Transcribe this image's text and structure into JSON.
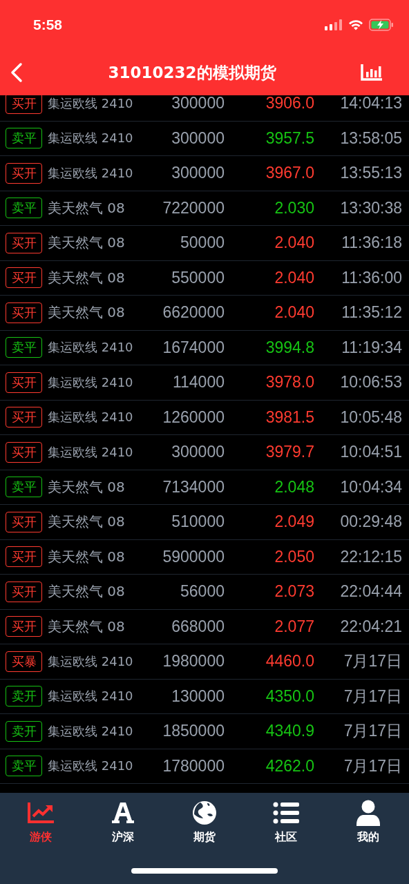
{
  "status_bar": {
    "time": "5:58"
  },
  "header": {
    "title": "31010232的模拟期货"
  },
  "trades": [
    {
      "kind": "buy",
      "action": "买开",
      "contract": "集运欧线 2410",
      "quantity": "300000",
      "price": "3906.0",
      "time": "14:04:13"
    },
    {
      "kind": "sell",
      "action": "卖平",
      "contract": "集运欧线 2410",
      "quantity": "300000",
      "price": "3957.5",
      "time": "13:58:05"
    },
    {
      "kind": "buy",
      "action": "买开",
      "contract": "集运欧线 2410",
      "quantity": "300000",
      "price": "3967.0",
      "time": "13:55:13"
    },
    {
      "kind": "sell",
      "action": "卖平",
      "contract": "美天然气 08",
      "quantity": "7220000",
      "price": "2.030",
      "time": "13:30:38"
    },
    {
      "kind": "buy",
      "action": "买开",
      "contract": "美天然气 08",
      "quantity": "50000",
      "price": "2.040",
      "time": "11:36:18"
    },
    {
      "kind": "buy",
      "action": "买开",
      "contract": "美天然气 08",
      "quantity": "550000",
      "price": "2.040",
      "time": "11:36:00"
    },
    {
      "kind": "buy",
      "action": "买开",
      "contract": "美天然气 08",
      "quantity": "6620000",
      "price": "2.040",
      "time": "11:35:12"
    },
    {
      "kind": "sell",
      "action": "卖平",
      "contract": "集运欧线 2410",
      "quantity": "1674000",
      "price": "3994.8",
      "time": "11:19:34"
    },
    {
      "kind": "buy",
      "action": "买开",
      "contract": "集运欧线 2410",
      "quantity": "114000",
      "price": "3978.0",
      "time": "10:06:53"
    },
    {
      "kind": "buy",
      "action": "买开",
      "contract": "集运欧线 2410",
      "quantity": "1260000",
      "price": "3981.5",
      "time": "10:05:48"
    },
    {
      "kind": "buy",
      "action": "买开",
      "contract": "集运欧线 2410",
      "quantity": "300000",
      "price": "3979.7",
      "time": "10:04:51"
    },
    {
      "kind": "sell",
      "action": "卖平",
      "contract": "美天然气 08",
      "quantity": "7134000",
      "price": "2.048",
      "time": "10:04:34"
    },
    {
      "kind": "buy",
      "action": "买开",
      "contract": "美天然气 08",
      "quantity": "510000",
      "price": "2.049",
      "time": "00:29:48"
    },
    {
      "kind": "buy",
      "action": "买开",
      "contract": "美天然气 08",
      "quantity": "5900000",
      "price": "2.050",
      "time": "22:12:15"
    },
    {
      "kind": "buy",
      "action": "买开",
      "contract": "美天然气 08",
      "quantity": "56000",
      "price": "2.073",
      "time": "22:04:44"
    },
    {
      "kind": "buy",
      "action": "买开",
      "contract": "美天然气 08",
      "quantity": "668000",
      "price": "2.077",
      "time": "22:04:21"
    },
    {
      "kind": "buy",
      "action": "买暴",
      "contract": "集运欧线 2410",
      "quantity": "1980000",
      "price": "4460.0",
      "time": "7月17日"
    },
    {
      "kind": "sell",
      "action": "卖开",
      "contract": "集运欧线 2410",
      "quantity": "130000",
      "price": "4350.0",
      "time": "7月17日"
    },
    {
      "kind": "sell",
      "action": "卖开",
      "contract": "集运欧线 2410",
      "quantity": "1850000",
      "price": "4340.9",
      "time": "7月17日"
    },
    {
      "kind": "sell",
      "action": "卖平",
      "contract": "集运欧线 2410",
      "quantity": "1780000",
      "price": "4262.0",
      "time": "7月17日"
    }
  ],
  "tab_bar": [
    {
      "kind": "chart",
      "label": "游侠",
      "selected": true
    },
    {
      "kind": "letter",
      "label": "沪深",
      "selected": false
    },
    {
      "kind": "globe",
      "label": "期货",
      "selected": false
    },
    {
      "kind": "list",
      "label": "社区",
      "selected": false
    },
    {
      "kind": "user",
      "label": "我的",
      "selected": false
    }
  ]
}
